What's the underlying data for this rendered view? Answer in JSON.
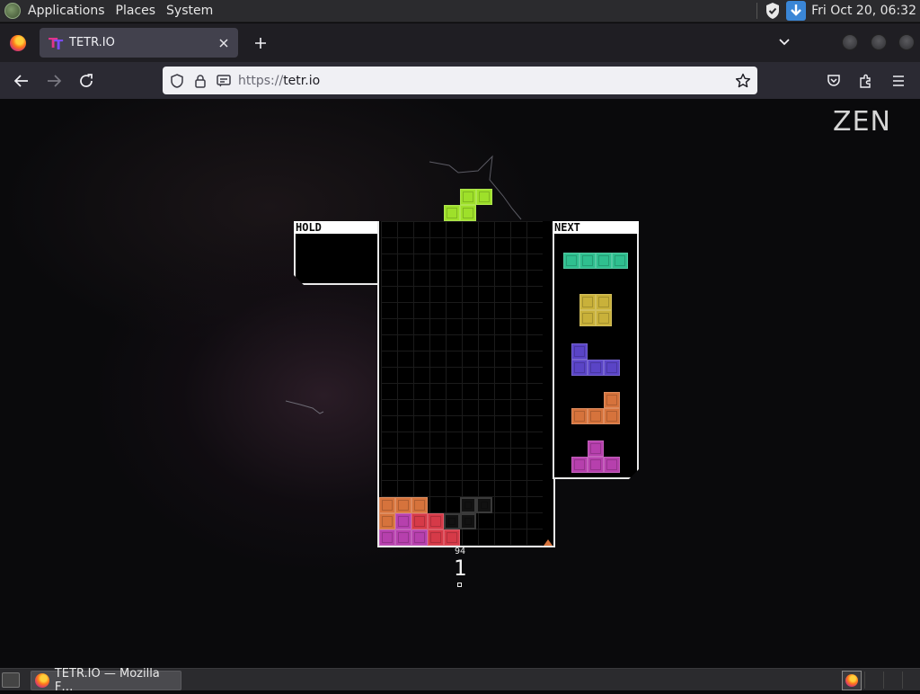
{
  "top_panel": {
    "menus": [
      "Applications",
      "Places",
      "System"
    ],
    "clock": "Fri Oct 20, 06:32"
  },
  "browser": {
    "tab_title": "TETR.IO",
    "favicon_letters": [
      "T",
      "T"
    ],
    "url_scheme": "https://",
    "url_host": "tetr.io"
  },
  "game": {
    "mode": "ZEN",
    "hold_label": "HOLD",
    "next_label": "NEXT",
    "lines_small": "94",
    "lines_big": "1",
    "colors": {
      "S": "#9ee02a",
      "I": "#2fbf8f",
      "O": "#c9b13a",
      "J": "#5a44c6",
      "L": "#d6733c",
      "T": "#b640ad",
      "Z": "#d63a48",
      "G": "#2b2b2b"
    },
    "falling_piece": {
      "type": "S",
      "cells": [
        [
          1,
          0
        ],
        [
          2,
          0
        ],
        [
          0,
          1
        ],
        [
          1,
          1
        ]
      ]
    },
    "next_queue": [
      {
        "type": "I",
        "cells": [
          [
            0,
            0
          ],
          [
            1,
            0
          ],
          [
            2,
            0
          ],
          [
            3,
            0
          ]
        ]
      },
      {
        "type": "O",
        "cells": [
          [
            0,
            0
          ],
          [
            1,
            0
          ],
          [
            0,
            1
          ],
          [
            1,
            1
          ]
        ]
      },
      {
        "type": "J",
        "cells": [
          [
            0,
            0
          ],
          [
            0,
            1
          ],
          [
            1,
            1
          ],
          [
            2,
            1
          ]
        ]
      },
      {
        "type": "L",
        "cells": [
          [
            2,
            0
          ],
          [
            0,
            1
          ],
          [
            1,
            1
          ],
          [
            2,
            1
          ]
        ]
      },
      {
        "type": "T",
        "cells": [
          [
            1,
            0
          ],
          [
            0,
            1
          ],
          [
            1,
            1
          ],
          [
            2,
            1
          ]
        ]
      }
    ],
    "board_stack": [
      {
        "col": 0,
        "row": 17,
        "type": "L"
      },
      {
        "col": 1,
        "row": 17,
        "type": "L"
      },
      {
        "col": 2,
        "row": 17,
        "type": "L"
      },
      {
        "col": 5,
        "row": 17,
        "type": "G"
      },
      {
        "col": 6,
        "row": 17,
        "type": "G"
      },
      {
        "col": 0,
        "row": 18,
        "type": "L"
      },
      {
        "col": 1,
        "row": 18,
        "type": "T"
      },
      {
        "col": 2,
        "row": 18,
        "type": "Z"
      },
      {
        "col": 3,
        "row": 18,
        "type": "Z"
      },
      {
        "col": 4,
        "row": 18,
        "type": "G"
      },
      {
        "col": 5,
        "row": 18,
        "type": "G"
      },
      {
        "col": 0,
        "row": 19,
        "type": "T"
      },
      {
        "col": 1,
        "row": 19,
        "type": "T"
      },
      {
        "col": 2,
        "row": 19,
        "type": "T"
      },
      {
        "col": 3,
        "row": 19,
        "type": "Z"
      },
      {
        "col": 4,
        "row": 19,
        "type": "Z"
      }
    ]
  },
  "taskbar": {
    "window_title": "TETR.IO — Mozilla F…"
  }
}
